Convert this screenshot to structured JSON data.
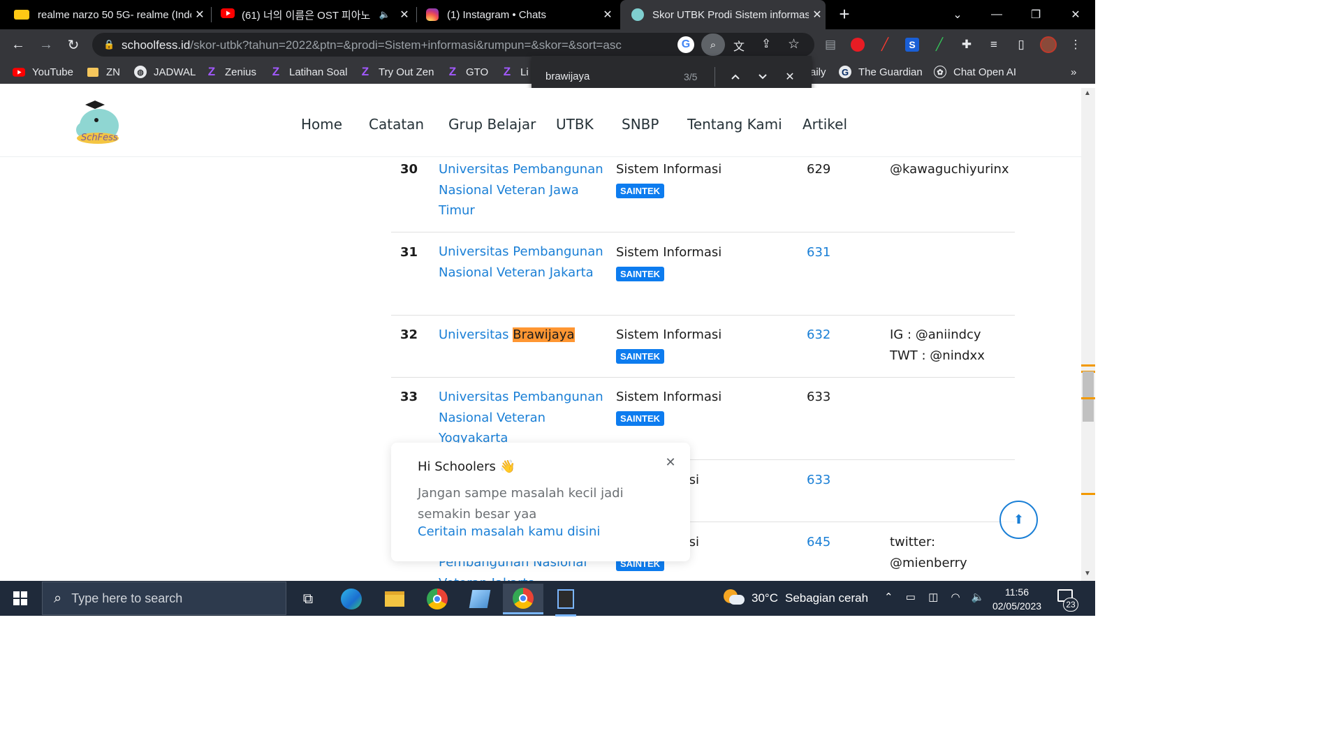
{
  "browser": {
    "tabs": [
      {
        "title": "realme narzo 50 5G- realme (Indo",
        "favicon": "realme-logo"
      },
      {
        "title": "(61) 너의 이름은 OST 피아노",
        "favicon": "youtube-icon"
      },
      {
        "title": "(1) Instagram • Chats",
        "favicon": "instagram-icon"
      },
      {
        "title": "Skor UTBK Prodi Sistem informasi",
        "favicon": "schoolfess-icon",
        "active": true
      }
    ],
    "new_tab": "+",
    "url_host": "schoolfess.id",
    "url_path": "/skor-utbk?tahun=2022&ptn=&prodi=Sistem+informasi&rumpun=&skor=&sort=asc",
    "bookmarks": [
      {
        "label": "YouTube",
        "icon": "youtube-icon"
      },
      {
        "label": "ZN",
        "icon": "folder-icon"
      },
      {
        "label": "JADWAL",
        "icon": "globe-icon"
      },
      {
        "label": "Zenius",
        "icon": "zenius-icon"
      },
      {
        "label": "Latihan Soal",
        "icon": "zenius-icon"
      },
      {
        "label": "Try Out Zen",
        "icon": "zenius-icon"
      },
      {
        "label": "GTO",
        "icon": "zenius-icon"
      },
      {
        "label": "Li",
        "icon": "zenius-icon"
      },
      {
        "label": "aily",
        "icon": ""
      },
      {
        "label": "The Guardian",
        "icon": "guardian-icon"
      },
      {
        "label": "Chat Open AI",
        "icon": "openai-icon"
      }
    ],
    "bookmarks_more": "»"
  },
  "findbar": {
    "query": "brawijaya",
    "count": "3/5"
  },
  "site": {
    "nav": [
      "Home",
      "Catatan",
      "Grup Belajar",
      "UTBK",
      "SNBP",
      "Tentang Kami",
      "Artikel"
    ]
  },
  "table": {
    "rows": [
      {
        "rank": "30",
        "univ": "Universitas Pembangunan Nasional Veteran Jawa Timur",
        "prodi": "Sistem Informasi",
        "rumpun": "SAINTEK",
        "skor": "629",
        "skor_link": false,
        "ket": "@kawaguchiyurinx"
      },
      {
        "rank": "31",
        "univ": "Universitas Pembangunan Nasional Veteran Jakarta",
        "prodi": "Sistem Informasi",
        "rumpun": "SAINTEK",
        "skor": "631",
        "skor_link": true,
        "ket": ""
      },
      {
        "rank": "32",
        "univ_pre": "Universitas ",
        "univ_hl": "Brawijaya",
        "prodi": "Sistem Informasi",
        "rumpun": "SAINTEK",
        "skor": "632",
        "skor_link": true,
        "ket_lines": [
          "IG : @aniindcy",
          "TWT : @nindxx"
        ]
      },
      {
        "rank": "33",
        "univ": "Universitas Pembangunan Nasional Veteran Yogyakarta",
        "prodi": "Sistem Informasi",
        "rumpun": "SAINTEK",
        "skor": "633",
        "skor_link": false,
        "ket": ""
      },
      {
        "rank": "",
        "prodi_partial": "masi",
        "skor": "633",
        "skor_link": true
      },
      {
        "rank": "",
        "univ_partial": "Pembangunan Nasional",
        "univ_partial2": "Veteran Jakarta",
        "prodi_partial": "masi",
        "rumpun": "SAINTEK",
        "skor": "645",
        "skor_link": true,
        "ket_lines": [
          "twitter:",
          "@mienberry"
        ]
      }
    ]
  },
  "popup": {
    "title": "Hi Schoolers",
    "emoji": "👋",
    "body": "Jangan sampe masalah kecil jadi semakin besar yaa",
    "link": "Ceritain masalah kamu disini"
  },
  "taskbar": {
    "search_placeholder": "Type here to search",
    "weather_temp": "30°C",
    "weather_desc": "Sebagian cerah",
    "time": "11:56",
    "date": "02/05/2023",
    "notif_count": "23"
  }
}
